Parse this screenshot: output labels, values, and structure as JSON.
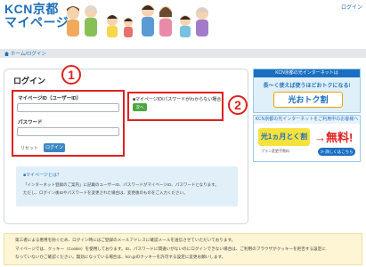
{
  "header": {
    "logo_line1": "KCN京都",
    "logo_line2": "マイページ",
    "login_link": "ログイン"
  },
  "breadcrumb": {
    "home": "ホーム",
    "separator": "/",
    "current": "ログイン"
  },
  "main": {
    "title": "ログイン",
    "id_label": "マイページID（ユーザーID）",
    "id_value": "",
    "password_label": "パスワード",
    "password_value": "",
    "reset_label": "リセット",
    "login_label": "ログイン",
    "forgot_text": "■マイページID/パスワードがわからない場合",
    "next_label": "次へ",
    "badge1": "1",
    "badge2": "2"
  },
  "help": {
    "title": "■マイページとは？",
    "line1": "「インターネット登録のご案内」に記載のユーザーID、パスワードがマイページID、パスワードとなります。",
    "line2": "ただし、ログイン後IDやパスワードを変更された場合は、変更後のものをご入力ください。"
  },
  "banners": {
    "b1_head": "KCN京都の光インターネットは",
    "b1_sub": "長〜く使えば使うほどおトクになる!",
    "b1_main": "光おトク割",
    "b2_head": "KCN京都の光インターネットをご利用中のお客様へ",
    "b2_badge": "光1ヵ月とく割",
    "b2_free": "→無料!",
    "b2_note": "プラン変更手数料",
    "b2_more": "≫ 詳しくはこちら"
  },
  "notice": {
    "line1": "第三者による悪用を防ぐため、ログイン時にはご登録のメールアドレスに確認メールを送信させていただいております。",
    "line2": "マイページでは、クッキー（Cookie）を使用しております。ID、パスワードに間違いがないのにログインできない場合は、ご利用のブラウザがクッキーを拒否する設定に",
    "line3": "なっていないかご確認ください。無効になっている場合は、kcn.jpのクッキーを許可する設定に変更お願いします。"
  },
  "colors": {
    "brand_blue": "#1f6fb8",
    "highlight_red": "#e02020",
    "next_green": "#4aa83c",
    "notice_bg": "#fdf5d4"
  }
}
